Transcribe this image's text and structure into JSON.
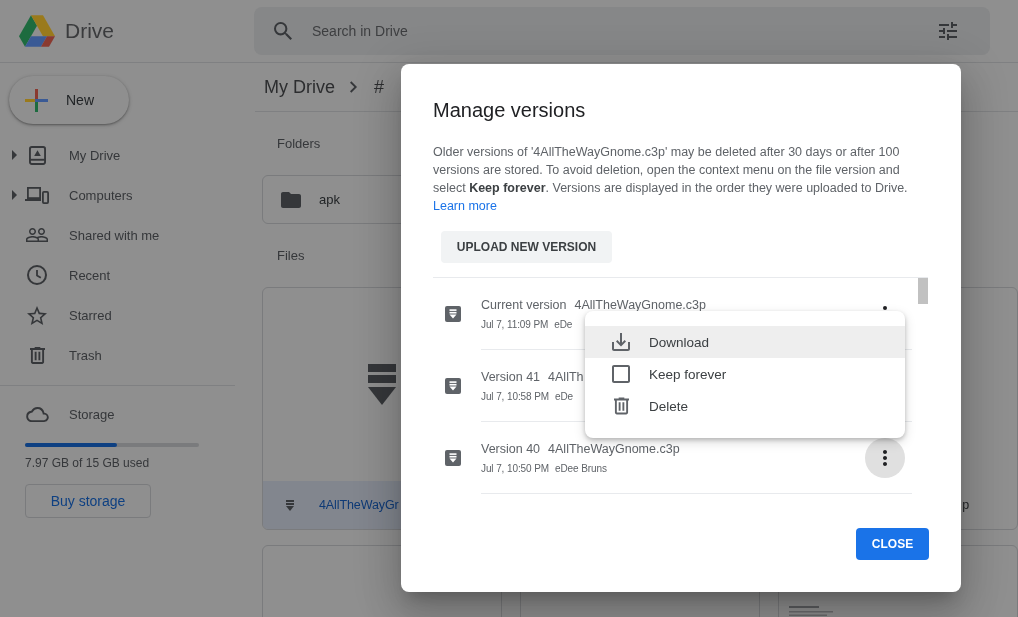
{
  "header": {
    "app_name": "Drive",
    "search": {
      "placeholder": "Search in Drive"
    }
  },
  "sidebar": {
    "new_button": "New",
    "items": [
      {
        "label": "My Drive",
        "expandable": true
      },
      {
        "label": "Computers",
        "expandable": true
      },
      {
        "label": "Shared with me",
        "expandable": false
      },
      {
        "label": "Recent",
        "expandable": false
      },
      {
        "label": "Starred",
        "expandable": false
      },
      {
        "label": "Trash",
        "expandable": false
      }
    ],
    "storage": {
      "label": "Storage",
      "level": 0.53,
      "usage": "7.97 GB of 15 GB used",
      "button": "Buy storage"
    }
  },
  "main": {
    "breadcrumb": [
      "My Drive",
      "#"
    ],
    "folders": {
      "heading": "Folders",
      "items": [
        {
          "name": "apk"
        }
      ]
    },
    "files": {
      "heading": "Files",
      "items": [
        {
          "kind": "file",
          "name": "4AllTheWayGr",
          "selected": true
        },
        {
          "kind": "clipped",
          "name": "p",
          "selected": false
        },
        {
          "kind": "blank"
        },
        {
          "kind": "blank"
        },
        {
          "kind": "document"
        }
      ]
    }
  },
  "dialog": {
    "title": "Manage versions",
    "description": "Older versions of '4AllTheWayGnome.c3p' may be deleted after 30 days or after 100 versions are stored. To avoid deletion, open the context menu on the file version and select **Keep forever**. Versions are displayed in the order they were uploaded to Drive.",
    "link": "Learn more",
    "upload_button": "UPLOAD NEW VERSION",
    "versions": [
      {
        "label": "Current version",
        "file_name": "4AllTheWayGnome.c3p",
        "date": "Jul 7, 11:09 PM",
        "author": "eDe",
        "hovered": false,
        "menu_open": true
      },
      {
        "label": "Version 41",
        "file_name": "4AllTh",
        "date": "Jul 7, 10:58 PM",
        "author": "eDe",
        "hovered": false,
        "menu_open": false
      },
      {
        "label": "Version 40",
        "file_name": "4AllTheWayGnome.c3p",
        "date": "Jul 7, 10:50 PM",
        "author": "eDee Bruns",
        "hovered": true,
        "menu_open": false
      }
    ],
    "context_menu": {
      "items": [
        {
          "label": "Download",
          "kind": "action",
          "highlighted": true
        },
        {
          "label": "Keep forever",
          "kind": "toggle",
          "checked": false,
          "highlighted": false
        },
        {
          "label": "Delete",
          "kind": "action",
          "highlighted": false
        }
      ]
    },
    "close_button": "CLOSE"
  }
}
